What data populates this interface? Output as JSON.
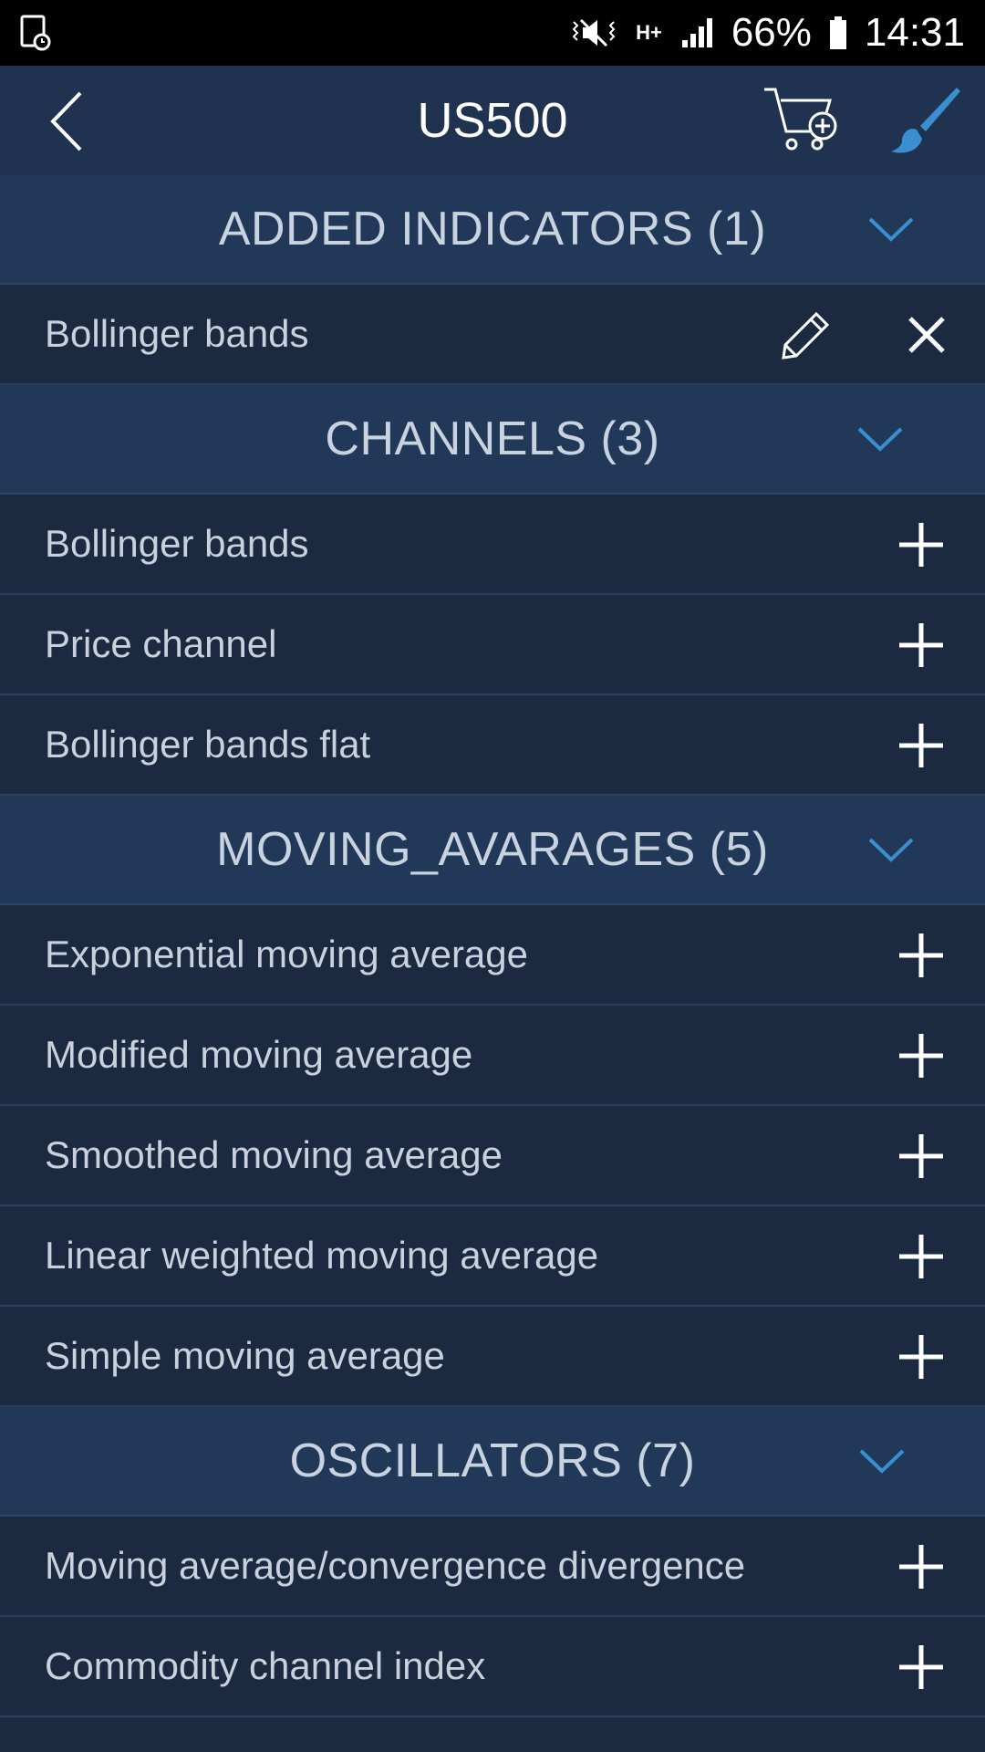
{
  "status_bar": {
    "battery": "66%",
    "time": "14:31",
    "network": "H+",
    "icons": [
      "screenshot-icon",
      "mute-vibrate-icon",
      "signal-icon",
      "battery-icon"
    ]
  },
  "header": {
    "title": "US500",
    "icons": [
      "back-arrow-icon",
      "cart-add-icon",
      "brush-icon"
    ]
  },
  "colors": {
    "accent": "#3a8fd0",
    "background": "#1b2a40",
    "section": "#213859",
    "header": "#1f3350"
  },
  "sections": [
    {
      "label": "ADDED INDICATORS (1)",
      "items": [
        {
          "label": "Bollinger bands",
          "actions": [
            "edit",
            "remove"
          ]
        }
      ]
    },
    {
      "label": "CHANNELS (3)",
      "items": [
        {
          "label": "Bollinger bands",
          "actions": [
            "add"
          ]
        },
        {
          "label": "Price channel",
          "actions": [
            "add"
          ]
        },
        {
          "label": "Bollinger bands flat",
          "actions": [
            "add"
          ]
        }
      ]
    },
    {
      "label": "MOVING_AVARAGES (5)",
      "items": [
        {
          "label": "Exponential moving average",
          "actions": [
            "add"
          ]
        },
        {
          "label": "Modified moving average",
          "actions": [
            "add"
          ]
        },
        {
          "label": "Smoothed moving average",
          "actions": [
            "add"
          ]
        },
        {
          "label": "Linear weighted moving average",
          "actions": [
            "add"
          ]
        },
        {
          "label": "Simple moving average",
          "actions": [
            "add"
          ]
        }
      ]
    },
    {
      "label": "OSCILLATORS (7)",
      "items": [
        {
          "label": "Moving average/convergence divergence",
          "actions": [
            "add"
          ]
        },
        {
          "label": "Commodity channel index",
          "actions": [
            "add"
          ]
        }
      ]
    }
  ]
}
